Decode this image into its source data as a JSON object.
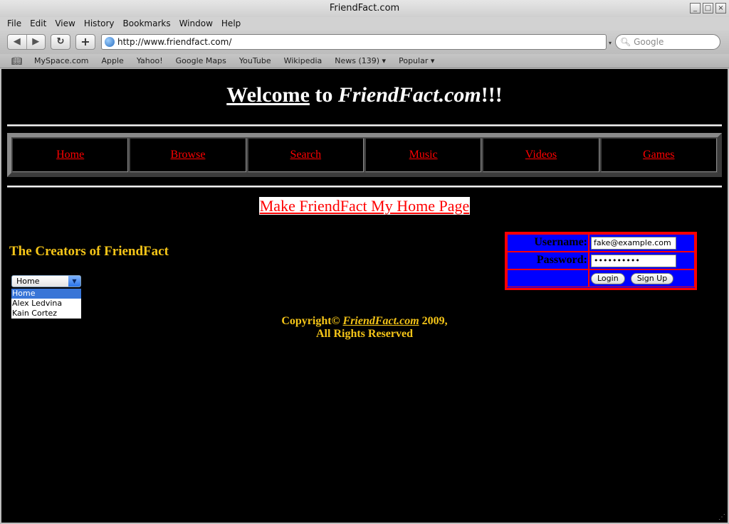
{
  "window": {
    "title": "FriendFact.com",
    "controls": [
      "_",
      "□",
      "×"
    ]
  },
  "menu": [
    "File",
    "Edit",
    "View",
    "History",
    "Bookmarks",
    "Window",
    "Help"
  ],
  "toolbar": {
    "back": "◀",
    "forward": "▶",
    "reload": "↻",
    "add": "+",
    "url": "http://www.friendfact.com/",
    "search_placeholder": "Google"
  },
  "bookmarks": [
    "MySpace.com",
    "Apple",
    "Yahoo!",
    "Google Maps",
    "YouTube",
    "Wikipedia",
    "News (139) ▾",
    "Popular ▾"
  ],
  "page": {
    "welcome_1": "Welcome",
    "welcome_2": " to ",
    "welcome_3": "FriendFact.com",
    "welcome_4": "!!!",
    "nav": [
      "Home",
      "Browse",
      "Search",
      "Music",
      "Videos",
      "Games"
    ],
    "homepage_link": "Make FriendFact My Home Page",
    "creators_title": "The Creators of FriendFact",
    "select": {
      "value": "Home",
      "options": [
        "Home",
        "Alex Ledvina",
        "Kain Cortez"
      ]
    },
    "login": {
      "username_label": "Username:",
      "username_value": "fake@example.com",
      "password_label": "Password:",
      "password_value": "••••••••••",
      "login_button": "Login",
      "signup_button": "Sign Up"
    },
    "copyright_1": "Copyright© ",
    "copyright_link": "FriendFact.com",
    "copyright_2": " 2009,",
    "copyright_3": "All Rights Reserved"
  },
  "colors": {
    "page_bg": "#000000",
    "link_red": "#ff0000",
    "gold": "#f5c518",
    "login_blue": "#0000ff"
  }
}
